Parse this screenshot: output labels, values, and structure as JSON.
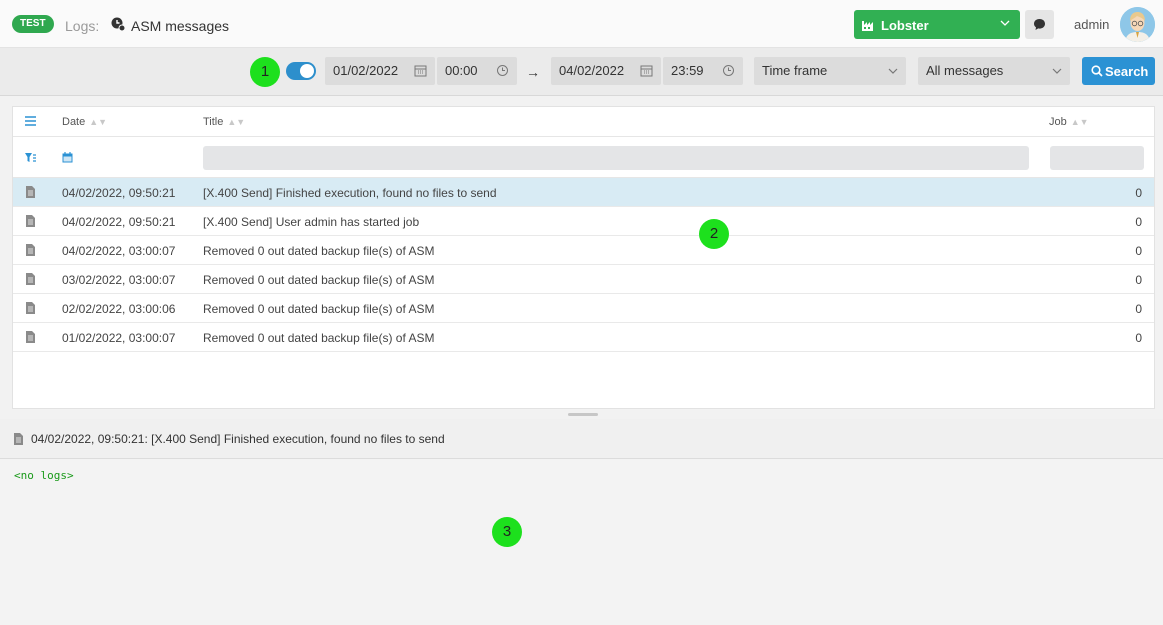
{
  "header": {
    "env_badge": "TEST",
    "breadcrumb_label": "Logs:",
    "breadcrumb_icon": "clock-user-icon",
    "page_title": "ASM messages",
    "company": "Lobster",
    "company_icon": "factory-icon",
    "chat_icon": "chat-icon",
    "user_name": "admin"
  },
  "toolbar": {
    "toggle_on": true,
    "start_date": "01/02/2022",
    "start_time": "00:00",
    "arrow": "→",
    "end_date": "04/02/2022",
    "end_time": "23:59",
    "time_frame": "Time frame",
    "message_filter": "All messages",
    "search_label": "Search"
  },
  "markers": {
    "m1": "1",
    "m2": "2",
    "m3": "3"
  },
  "grid": {
    "columns": {
      "date": "Date",
      "title": "Title",
      "job": "Job"
    },
    "rows": [
      {
        "date": "04/02/2022, 09:50:21",
        "title": "[X.400 Send] Finished execution, found no files to send",
        "job": "0",
        "selected": true
      },
      {
        "date": "04/02/2022, 09:50:21",
        "title": "[X.400 Send] User admin has started job",
        "job": "0",
        "selected": false
      },
      {
        "date": "04/02/2022, 03:00:07",
        "title": "Removed 0 out dated backup file(s) of ASM",
        "job": "0",
        "selected": false
      },
      {
        "date": "03/02/2022, 03:00:07",
        "title": "Removed 0 out dated backup file(s) of ASM",
        "job": "0",
        "selected": false
      },
      {
        "date": "02/02/2022, 03:00:06",
        "title": "Removed 0 out dated backup file(s) of ASM",
        "job": "0",
        "selected": false
      },
      {
        "date": "01/02/2022, 03:00:07",
        "title": "Removed 0 out dated backup file(s) of ASM",
        "job": "0",
        "selected": false
      }
    ]
  },
  "detail": {
    "title": "04/02/2022, 09:50:21: [X.400 Send] Finished execution, found no files to send",
    "body": "<no logs>"
  },
  "colors": {
    "accent_green": "#31b053",
    "accent_blue": "#2b92d4",
    "selected_row": "#d8ebf4",
    "log_text": "#1a9a1a"
  }
}
